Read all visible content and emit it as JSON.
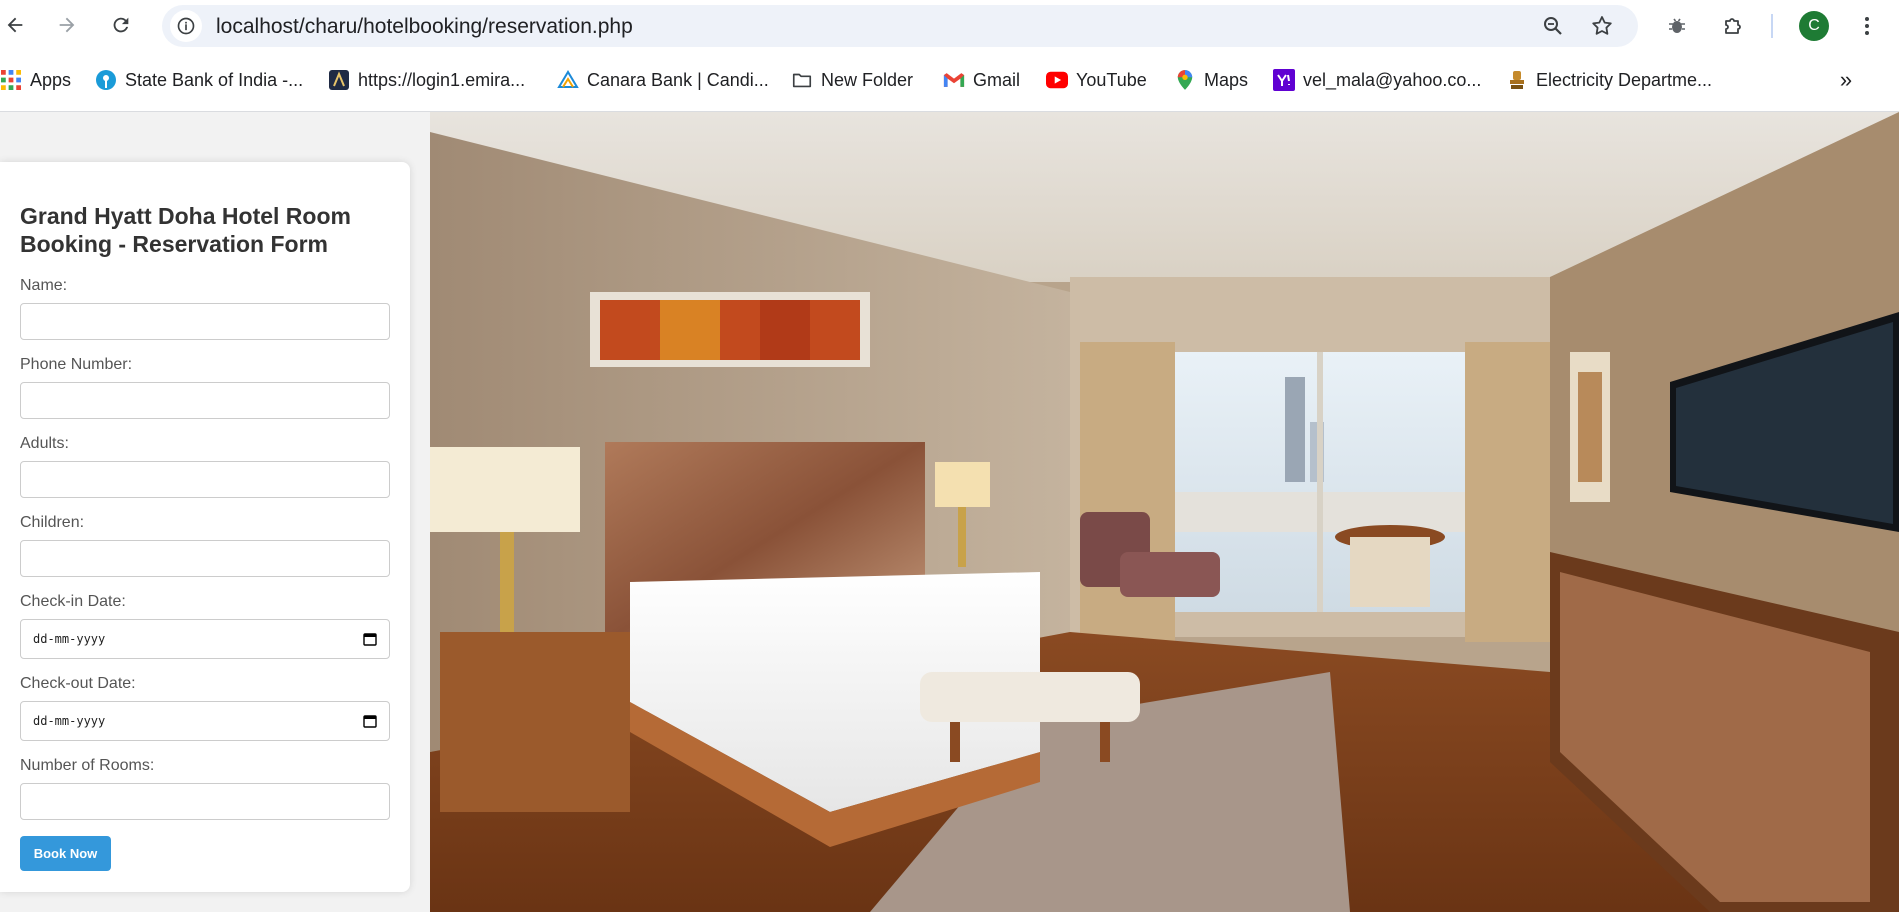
{
  "browser": {
    "url": "localhost/charu/hotelbooking/reservation.php",
    "avatar_letter": "C",
    "icons": [
      "back-arrow-icon",
      "forward-arrow-icon",
      "reload-icon",
      "site-info-icon",
      "zoom-icon",
      "bookmark-star-icon",
      "extension-bug-icon",
      "extensions-puzzle-icon",
      "more-vert-icon"
    ]
  },
  "bookmarks": [
    {
      "label": "Apps",
      "icon": "apps-grid-icon"
    },
    {
      "label": "State Bank of India -...",
      "icon": "sbi-icon"
    },
    {
      "label": "https://login1.emira...",
      "icon": "emirates-icon"
    },
    {
      "label": "Canara Bank | Candi...",
      "icon": "canara-icon"
    },
    {
      "label": "New Folder",
      "icon": "folder-icon"
    },
    {
      "label": "Gmail",
      "icon": "gmail-icon"
    },
    {
      "label": "YouTube",
      "icon": "youtube-icon"
    },
    {
      "label": "Maps",
      "icon": "maps-icon"
    },
    {
      "label": "vel_mala@yahoo.co...",
      "icon": "yahoo-icon"
    },
    {
      "label": "Electricity Departme...",
      "icon": "emblem-icon"
    }
  ],
  "form": {
    "title": "Grand Hyatt Doha Hotel Room Booking - Reservation Form",
    "name_label": "Name:",
    "phone_label": "Phone Number:",
    "adults_label": "Adults:",
    "children_label": "Children:",
    "checkin_label": "Check-in Date:",
    "checkin_value": "dd-mm-yyyy",
    "checkout_label": "Check-out Date:",
    "checkout_value": "dd-mm-yyyy",
    "rooms_label": "Number of Rooms:",
    "submit_label": "Book Now"
  },
  "colors": {
    "accent_button": "#3498db",
    "avatar": "#1e7b34",
    "omnibox": "#eef2f9"
  }
}
